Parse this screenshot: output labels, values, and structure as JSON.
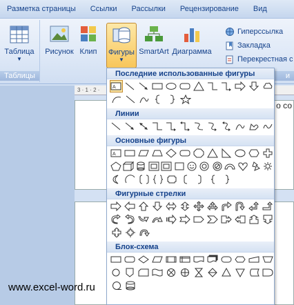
{
  "tabs": [
    "Разметка страницы",
    "Ссылки",
    "Рассылки",
    "Рецензирование",
    "Вид"
  ],
  "ribbon": {
    "tables_group_label": "Таблицы",
    "table_btn": "Таблица",
    "picture_btn": "Рисунок",
    "clip_btn": "Клип",
    "shapes_btn": "Фигуры",
    "smartart_btn": "SmartArt",
    "chart_btn": "Диаграмма",
    "links": {
      "hyperlink": "Гиперссылка",
      "bookmark": "Закладка",
      "crossref": "Перекрестная с"
    },
    "links_group_label_tail": "и"
  },
  "ruler_text": "3 · 1 · 2 ·",
  "page_text": "о со",
  "watermark": "www.excel-word.ru",
  "dropdown": {
    "recent_title": "Последние использованные фигуры",
    "lines_title": "Линии",
    "basic_title": "Основные фигуры",
    "arrows_title": "Фигурные стрелки",
    "flow_title": "Блок-схема"
  },
  "colors": {
    "accent": "#15428b",
    "ribbon_bg": "#dfe9f7",
    "active_btn": "#f8c65a"
  }
}
